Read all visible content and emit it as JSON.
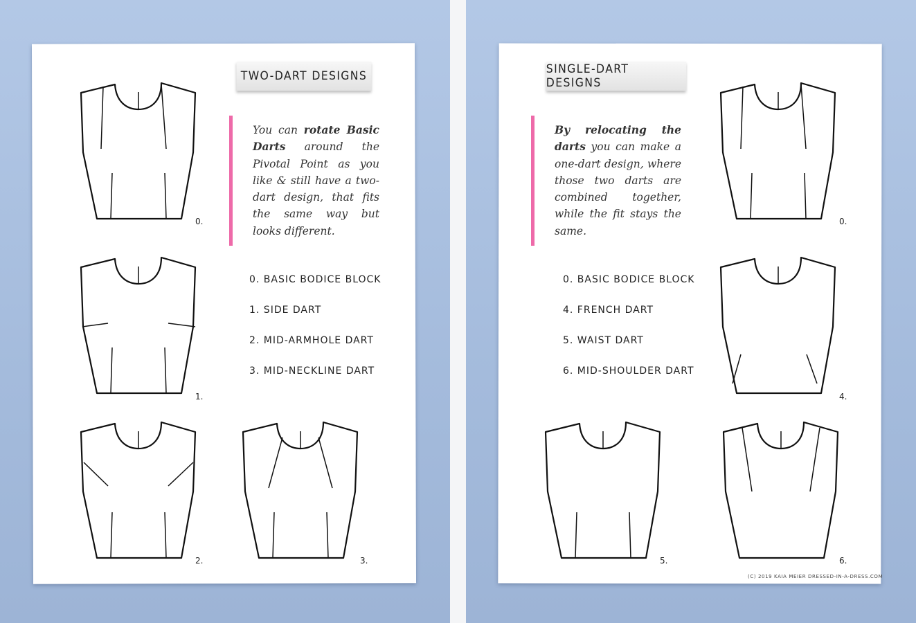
{
  "colors": {
    "background": "#a9bfdf",
    "accent_bar": "#ee6aa9"
  },
  "left": {
    "heading": "TWO-DART DESIGNS",
    "paragraph": [
      {
        "t": "You can ",
        "b": false
      },
      {
        "t": "rotate Basic Darts",
        "b": true
      },
      {
        "t": " around the Pivotal Point as you like & still have a two-dart design, that fits the same way but looks different.",
        "b": false
      }
    ],
    "list": [
      "0. BASIC BODICE BLOCK",
      "1. SIDE DART",
      "2. MID-ARMHOLE DART",
      "3. MID-NECKLINE DART"
    ],
    "figures": [
      {
        "label": "0.",
        "variant": "basic"
      },
      {
        "label": "1.",
        "variant": "side"
      },
      {
        "label": "2.",
        "variant": "mid-armhole"
      },
      {
        "label": "3.",
        "variant": "mid-neckline"
      }
    ]
  },
  "right": {
    "heading": "SINGLE-DART DESIGNS",
    "paragraph": [
      {
        "t": "By relocating the darts",
        "b": true
      },
      {
        "t": " you can make a one-dart design, where those two darts are combined together, while the fit stays the same.",
        "b": false
      }
    ],
    "list": [
      "0. BASIC BODICE BLOCK",
      "4. FRENCH DART",
      "5. WAIST DART",
      "6. MID-SHOULDER DART"
    ],
    "figures": [
      {
        "label": "0.",
        "variant": "basic"
      },
      {
        "label": "4.",
        "variant": "french"
      },
      {
        "label": "5.",
        "variant": "waist"
      },
      {
        "label": "6.",
        "variant": "mid-shoulder"
      }
    ],
    "footer": "(C) 2019 KAIA MEIER  DRESSED-IN-A-DRESS.COM"
  }
}
